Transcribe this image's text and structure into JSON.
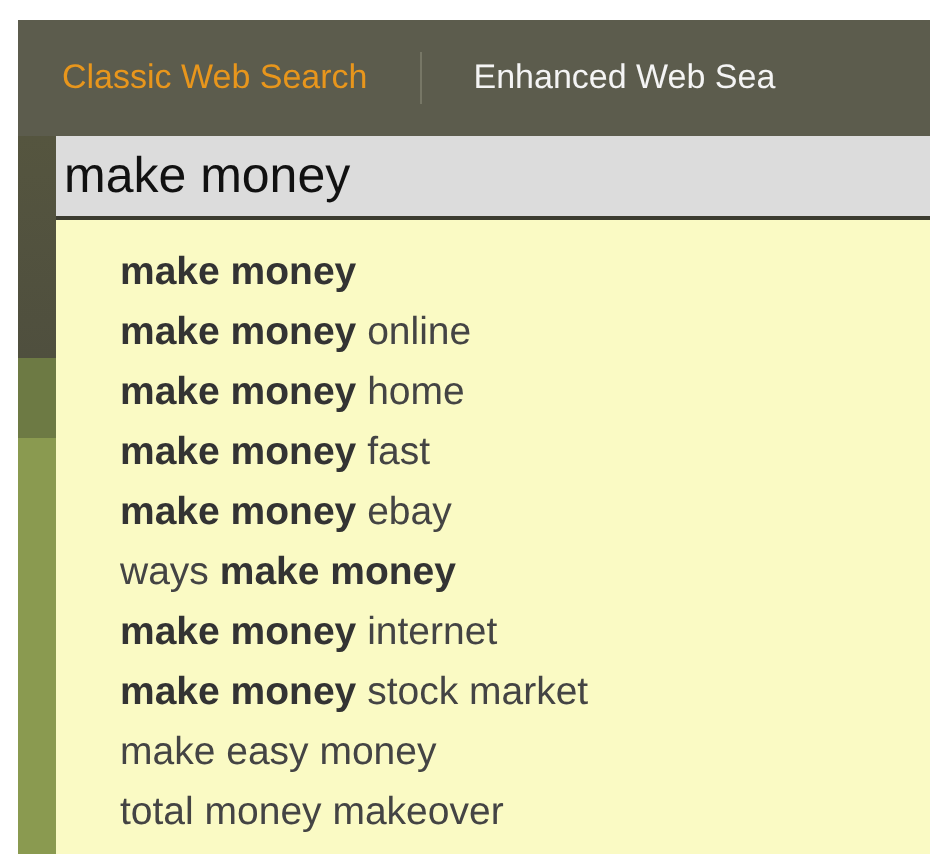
{
  "tabs": [
    {
      "label": "Classic Web Search",
      "selected": true
    },
    {
      "label": "Enhanced Web Sea",
      "selected": false
    }
  ],
  "search": {
    "value": "make money"
  },
  "suggestions": [
    {
      "text": "make money",
      "bold": true
    },
    {
      "text": "**make money** online",
      "bold": false
    },
    {
      "text": "**make money** home",
      "bold": false
    },
    {
      "text": "**make money** fast",
      "bold": false
    },
    {
      "text": "**make money** ebay",
      "bold": false
    },
    {
      "text": "ways **make money**",
      "bold": false
    },
    {
      "text": "**make money** internet",
      "bold": false
    },
    {
      "text": "**make money** stock market",
      "bold": false
    },
    {
      "text": "make easy money",
      "bold": false
    },
    {
      "text": "total money makeover",
      "bold": false
    }
  ]
}
